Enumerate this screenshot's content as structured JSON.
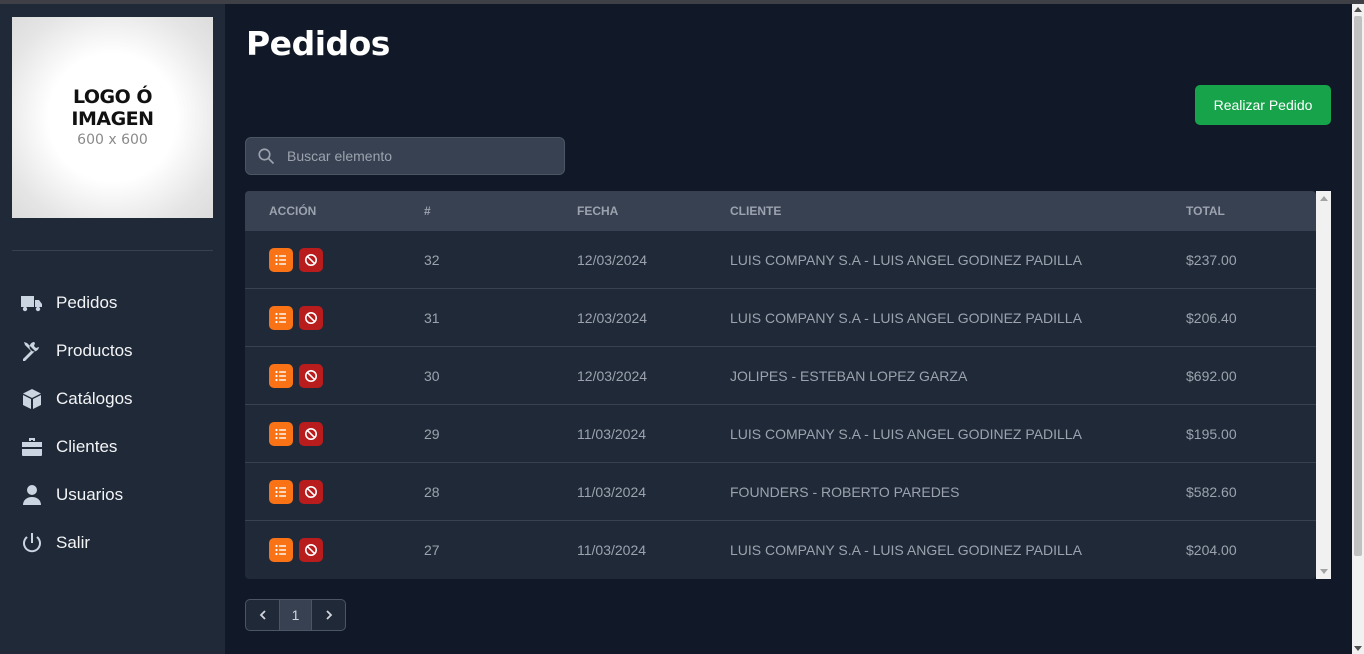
{
  "logo": {
    "line1": "LOGO Ó",
    "line2": "IMAGEN",
    "size": "600 x 600"
  },
  "sidebar": {
    "items": [
      {
        "label": "Pedidos",
        "icon": "truck-icon"
      },
      {
        "label": "Productos",
        "icon": "tools-icon"
      },
      {
        "label": "Catálogos",
        "icon": "box-icon"
      },
      {
        "label": "Clientes",
        "icon": "briefcase-icon"
      },
      {
        "label": "Usuarios",
        "icon": "user-icon"
      },
      {
        "label": "Salir",
        "icon": "power-icon"
      }
    ]
  },
  "page": {
    "title": "Pedidos",
    "primary_button": "Realizar Pedido"
  },
  "search": {
    "placeholder": "Buscar elemento",
    "value": ""
  },
  "table": {
    "headers": [
      "Acción",
      "#",
      "Fecha",
      "Cliente",
      "Total"
    ],
    "rows": [
      {
        "id": "32",
        "fecha": "12/03/2024",
        "cliente": "LUIS COMPANY S.A - LUIS ANGEL GODINEZ PADILLA",
        "total": "$237.00"
      },
      {
        "id": "31",
        "fecha": "12/03/2024",
        "cliente": "LUIS COMPANY S.A - LUIS ANGEL GODINEZ PADILLA",
        "total": "$206.40"
      },
      {
        "id": "30",
        "fecha": "12/03/2024",
        "cliente": "JOLIPES - ESTEBAN LOPEZ GARZA",
        "total": "$692.00"
      },
      {
        "id": "29",
        "fecha": "11/03/2024",
        "cliente": "LUIS COMPANY S.A - LUIS ANGEL GODINEZ PADILLA",
        "total": "$195.00"
      },
      {
        "id": "28",
        "fecha": "11/03/2024",
        "cliente": "FOUNDERS - ROBERTO PAREDES",
        "total": "$582.60"
      },
      {
        "id": "27",
        "fecha": "11/03/2024",
        "cliente": "LUIS COMPANY S.A - LUIS ANGEL GODINEZ PADILLA",
        "total": "$204.00"
      }
    ],
    "action_icons": [
      "list-icon",
      "ban-icon"
    ],
    "action_colors": {
      "detail": "#f97316",
      "cancel": "#b91c1c"
    }
  },
  "pagination": {
    "current_page": "1"
  },
  "colors": {
    "background": "#111827",
    "sidebar": "#1f2937",
    "accent": "#16a34a"
  }
}
